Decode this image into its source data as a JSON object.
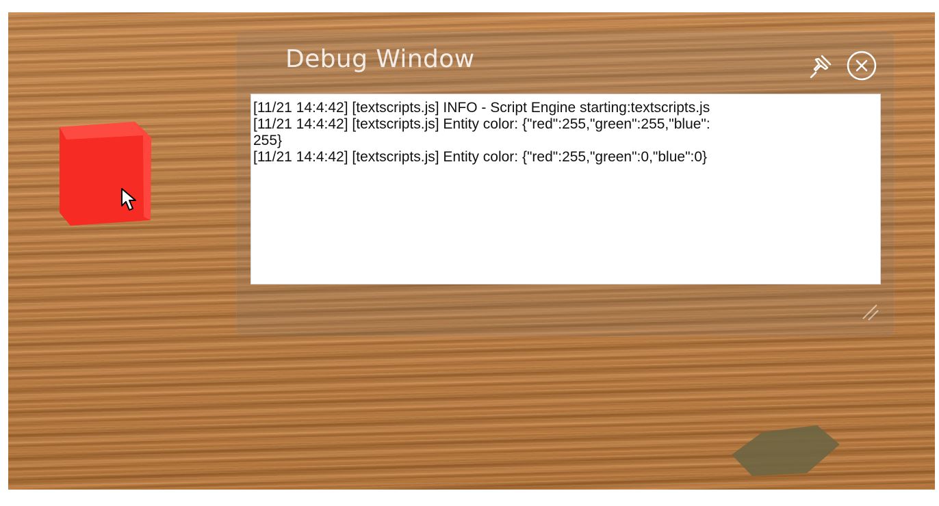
{
  "debug_window": {
    "title": "Debug Window",
    "log_lines": [
      "[11/21 14:4:42] [textscripts.js] INFO - Script Engine starting:textscripts.js",
      "[11/21 14:4:42] [textscripts.js] Entity color: {\"red\":255,\"green\":255,\"blue\":\n255}",
      "[11/21 14:4:42] [textscripts.js] Entity color: {\"red\":255,\"green\":0,\"blue\":0}"
    ]
  },
  "icons": {
    "pin": "pin-icon",
    "close": "close-icon",
    "resize": "resize-handle-icon",
    "cursor": "mouse-pointer-icon"
  },
  "colors": {
    "cube_front": "#f52a22",
    "cube_side": "#ff3b33",
    "panel_bg": "#ffffff",
    "title_text": "#ffffff"
  }
}
